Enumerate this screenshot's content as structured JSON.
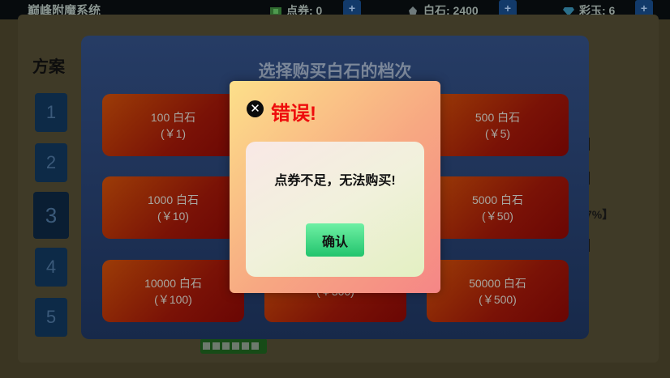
{
  "topbar": {
    "app_title": "巅峰附魔系统",
    "coupon": {
      "label": "点券: 0",
      "icon": "cash-icon"
    },
    "white_stone": {
      "label": "白石: 2400",
      "icon": "stone-icon"
    },
    "jade": {
      "label": "彩玉: 6",
      "icon": "gem-icon"
    },
    "plus_label": "+"
  },
  "page": {
    "plan_heading": "方案",
    "plan_buttons": [
      "1",
      "2",
      "3",
      "4",
      "5"
    ],
    "active_plan": "3",
    "right_fragment": "7%】"
  },
  "panel": {
    "title": "选择购买白石的档次",
    "tiers": [
      {
        "amount": "100 白石",
        "price": "(￥1)"
      },
      {
        "amount": "500 白石",
        "price": "(￥5)"
      },
      {
        "amount": "1000 白石",
        "price": "(￥10)"
      },
      {
        "amount": "5000 白石",
        "price": "(￥50)"
      },
      {
        "amount": "10000 白石",
        "price": "(￥100)"
      },
      {
        "amount": "",
        "price": "(￥300)"
      },
      {
        "amount": "50000 白石",
        "price": "(￥500)"
      }
    ]
  },
  "modal": {
    "title": "错误!",
    "icon": "close-circle-icon",
    "message": "点券不足，无法购买!",
    "confirm_label": "确认"
  },
  "colors": {
    "error_red": "#ee0c0c",
    "confirm_green": "#22c46d",
    "tier_orange": "#9c3c07",
    "panel_blue": "#263c65"
  }
}
